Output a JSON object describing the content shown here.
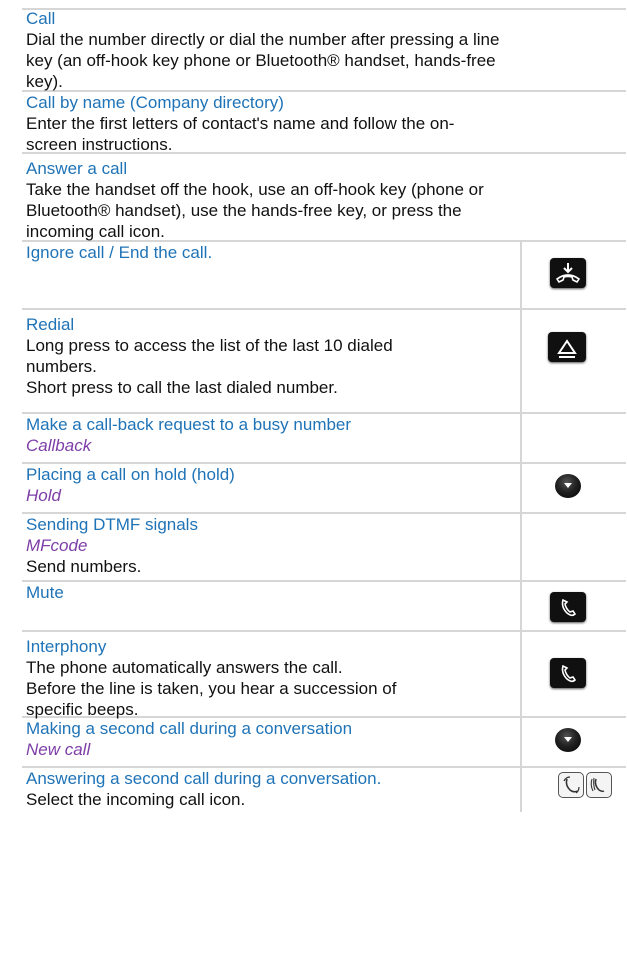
{
  "rows": [
    {
      "title": "Call",
      "lines": [
        "Dial the number directly or dial the number after pressing a line",
        "key (an off-hook key phone or Bluetooth® handset, hands-free",
        "key)."
      ]
    },
    {
      "title": "Call by name (Company directory)",
      "lines": [
        "Enter the first letters of contact's name and follow the on-",
        "screen instructions."
      ]
    },
    {
      "title": "Answer a call",
      "lines": [
        "Take the handset off the hook, use an off-hook key (phone or",
        "Bluetooth® handset), use the hands-free key, or press the",
        "incoming call icon."
      ]
    },
    {
      "title": "Ignore call / End the call.",
      "icon": "hang-up-key-icon"
    },
    {
      "title": "Redial",
      "lines": [
        "Long press to access the list of the last 10 dialed",
        "numbers.",
        "Short press to call the last dialed number."
      ],
      "icon": "redial-key-icon"
    },
    {
      "title": "Make a call-back request to a busy number",
      "softkey": "Callback"
    },
    {
      "title": "Placing a call on hold (hold)",
      "softkey": "Hold",
      "icon": "navigation-down-icon"
    },
    {
      "title": "Sending DTMF signals",
      "softkey": "MFcode",
      "lines": [
        "Send numbers."
      ]
    },
    {
      "title": "Mute",
      "icon": "mute-key-icon"
    },
    {
      "title": "Interphony",
      "lines": [
        "The phone automatically answers the call.",
        "Before the line is taken, you hear a succession of",
        "specific beeps."
      ],
      "icon": "interphony-key-icon"
    },
    {
      "title": "Making a second call during a conversation",
      "softkey": "New call",
      "icon": "navigation-down-icon"
    },
    {
      "title": "Answering a second call during a conversation.",
      "lines": [
        "Select the incoming call icon."
      ],
      "icon": "incoming-call-icons"
    }
  ]
}
